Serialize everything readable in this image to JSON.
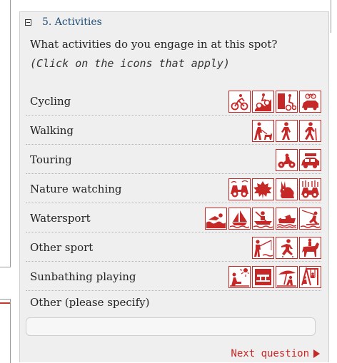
{
  "panel": {
    "title": "5. Activities",
    "question": "What activities do you engage in at this spot?",
    "hint": "(Click on the icons that apply)"
  },
  "rows": [
    {
      "label": "Cycling",
      "icons": [
        "road-cycling-icon",
        "mountain-biking-icon",
        "bike-trailer-icon",
        "car-bike-rack-icon"
      ]
    },
    {
      "label": "Walking",
      "icons": [
        "dog-walking-icon",
        "walking-icon",
        "hiking-icon"
      ]
    },
    {
      "label": "Touring",
      "icons": [
        "motorcycle-icon",
        "car-touring-icon"
      ]
    },
    {
      "label": "Nature watching",
      "icons": [
        "binoculars-icon",
        "leaf-icon",
        "rabbit-icon",
        "binoculars-reeds-icon"
      ]
    },
    {
      "label": "Watersport",
      "icons": [
        "swimming-icon",
        "sailing-icon",
        "canoeing-icon",
        "motorboat-icon",
        "waterskiing-icon"
      ]
    },
    {
      "label": "Other sport",
      "icons": [
        "fishing-icon",
        "skating-icon",
        "horse-riding-icon"
      ]
    },
    {
      "label": "Sunbathing playing",
      "icons": [
        "sunbathing-icon",
        "picnic-table-icon",
        "beach-umbrella-icon",
        "playground-icon"
      ]
    }
  ],
  "other": {
    "label": "Other (please specify)",
    "value": ""
  },
  "next_label": "Next question",
  "colors": {
    "accent": "#c62828",
    "title": "#1f4e79",
    "panel_bg": "#efefef"
  }
}
